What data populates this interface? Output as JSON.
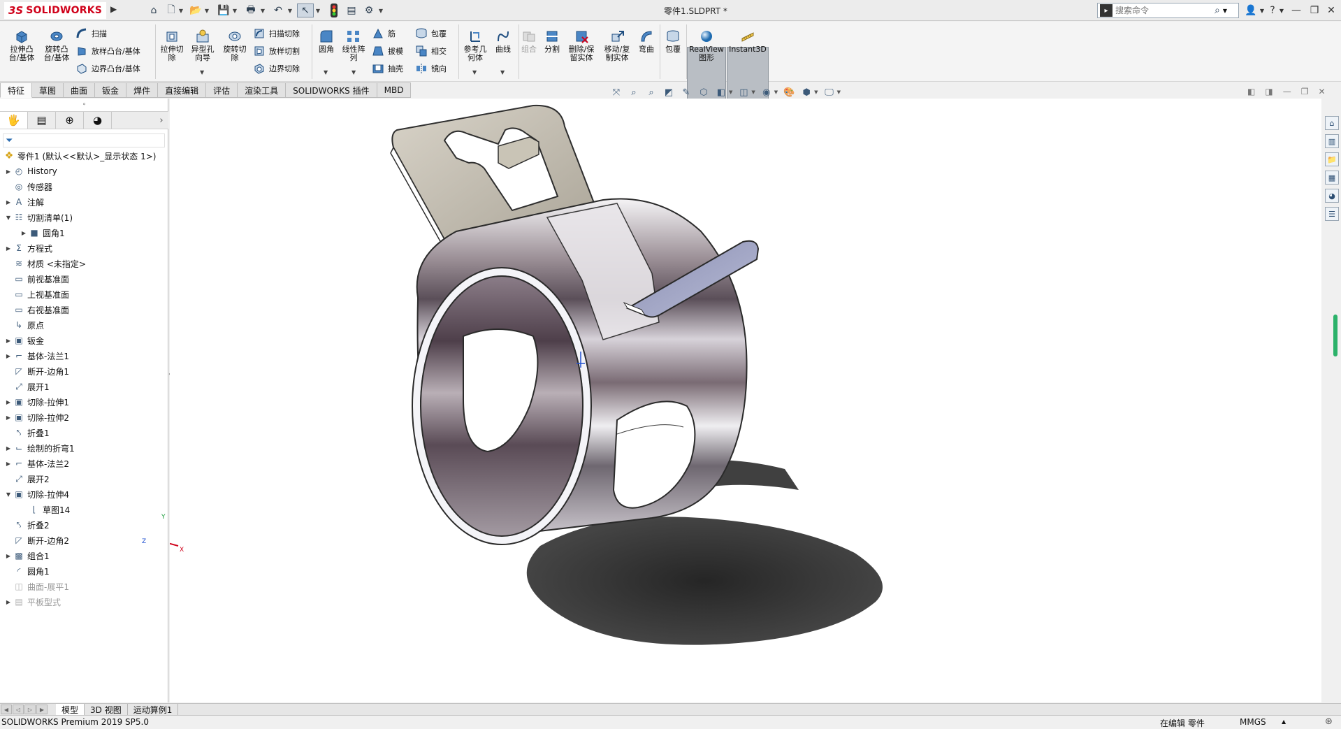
{
  "app": {
    "logo_ds": "3S",
    "logo_text": "SOLIDWORKS",
    "document_title": "零件1.SLDPRT *",
    "search_placeholder": "搜索命令"
  },
  "quick_access": [
    "home-icon",
    "new-icon",
    "open-icon",
    "save-icon",
    "print-icon",
    "undo-icon",
    "select-icon",
    "traffic-light-icon",
    "file-properties-icon",
    "options-icon"
  ],
  "ribbon": {
    "extrude_boss": "拉伸凸\n台/基体",
    "revolve_boss": "旋转凸\n台/基体",
    "sweep": "扫描",
    "loft_boss": "放样凸台/基体",
    "boundary_boss": "边界凸台/基体",
    "extrude_cut": "拉伸切\n除",
    "hole_wizard": "异型孔\n向导",
    "revolve_cut": "旋转切\n除",
    "swept_cut": "扫描切除",
    "lofted_cut": "放样切割",
    "boundary_cut": "边界切除",
    "fillet": "圆角",
    "linear_pattern": "线性阵\n列",
    "rib": "筋",
    "draft": "拔模",
    "shell": "抽壳",
    "wrap": "包覆",
    "intersect": "相交",
    "mirror": "镜向",
    "reference_geometry": "参考几\n何体",
    "curves": "曲线",
    "combine": "组合",
    "split": "分割",
    "delete_keep_body": "删除/保\n留实体",
    "move_copy_body": "移动/复\n制实体",
    "flex": "弯曲",
    "wrap2": "包覆",
    "realview": "RealView\n图形",
    "instant3d": "Instant3D"
  },
  "tabs": [
    "特征",
    "草图",
    "曲面",
    "钣金",
    "焊件",
    "直接编辑",
    "评估",
    "渲染工具",
    "SOLIDWORKS 插件",
    "MBD"
  ],
  "tree": {
    "root": "零件1 (默认<<默认>_显示状态 1>)",
    "items": [
      {
        "label": "History",
        "toggle": "closed",
        "indent": 0,
        "icon": "history-icon"
      },
      {
        "label": "传感器",
        "toggle": "none",
        "indent": 0,
        "icon": "sensor-icon"
      },
      {
        "label": "注解",
        "toggle": "closed",
        "indent": 0,
        "icon": "annotation-icon"
      },
      {
        "label": "切割清单(1)",
        "toggle": "open",
        "indent": 0,
        "icon": "cut-list-icon"
      },
      {
        "label": "圆角1",
        "toggle": "closed",
        "indent": 1,
        "icon": "solid-body-icon"
      },
      {
        "label": "方程式",
        "toggle": "closed",
        "indent": 0,
        "icon": "equation-icon"
      },
      {
        "label": "材质 <未指定>",
        "toggle": "none",
        "indent": 0,
        "icon": "material-icon"
      },
      {
        "label": "前视基准面",
        "toggle": "none",
        "indent": 0,
        "icon": "plane-icon"
      },
      {
        "label": "上视基准面",
        "toggle": "none",
        "indent": 0,
        "icon": "plane-icon"
      },
      {
        "label": "右视基准面",
        "toggle": "none",
        "indent": 0,
        "icon": "plane-icon"
      },
      {
        "label": "原点",
        "toggle": "none",
        "indent": 0,
        "icon": "origin-icon"
      },
      {
        "label": "钣金",
        "toggle": "closed",
        "indent": 0,
        "icon": "sheet-metal-icon"
      },
      {
        "label": "基体-法兰1",
        "toggle": "closed",
        "indent": 0,
        "icon": "base-flange-icon"
      },
      {
        "label": "断开-边角1",
        "toggle": "none",
        "indent": 0,
        "icon": "break-corner-icon"
      },
      {
        "label": "展开1",
        "toggle": "none",
        "indent": 0,
        "icon": "unfold-icon"
      },
      {
        "label": "切除-拉伸1",
        "toggle": "closed",
        "indent": 0,
        "icon": "extruded-cut-icon"
      },
      {
        "label": "切除-拉伸2",
        "toggle": "closed",
        "indent": 0,
        "icon": "extruded-cut-icon"
      },
      {
        "label": "折叠1",
        "toggle": "none",
        "indent": 0,
        "icon": "fold-icon"
      },
      {
        "label": "绘制的折弯1",
        "toggle": "closed",
        "indent": 0,
        "icon": "sketched-bend-icon"
      },
      {
        "label": "基体-法兰2",
        "toggle": "closed",
        "indent": 0,
        "icon": "base-flange-icon"
      },
      {
        "label": "展开2",
        "toggle": "none",
        "indent": 0,
        "icon": "unfold-icon"
      },
      {
        "label": "切除-拉伸4",
        "toggle": "open",
        "indent": 0,
        "icon": "extruded-cut-icon"
      },
      {
        "label": "草图14",
        "toggle": "none",
        "indent": 1,
        "icon": "sketch-icon"
      },
      {
        "label": "折叠2",
        "toggle": "none",
        "indent": 0,
        "icon": "fold-icon"
      },
      {
        "label": "断开-边角2",
        "toggle": "none",
        "indent": 0,
        "icon": "break-corner-icon"
      },
      {
        "label": "组合1",
        "toggle": "closed",
        "indent": 0,
        "icon": "combine-icon"
      },
      {
        "label": "圆角1",
        "toggle": "none",
        "indent": 0,
        "icon": "fillet-icon"
      },
      {
        "label": "曲面-展平1",
        "toggle": "none",
        "indent": 0,
        "icon": "surface-flatten-icon",
        "suppressed": true
      },
      {
        "label": "平板型式",
        "toggle": "closed",
        "indent": 0,
        "icon": "flat-pattern-icon",
        "suppressed": true
      }
    ]
  },
  "bottom_tabs": [
    "模型",
    "3D 视图",
    "运动算例1"
  ],
  "status": {
    "app_version": "SOLIDWORKS Premium 2019 SP5.0",
    "mode": "在编辑 零件",
    "units": "MMGS"
  },
  "triad": {
    "x": "X",
    "y": "Y",
    "z": "Z"
  },
  "colors": {
    "brand_red": "#d0021b",
    "accent_blue": "#3b7fc4",
    "model_steel": "#b8b3bd"
  }
}
